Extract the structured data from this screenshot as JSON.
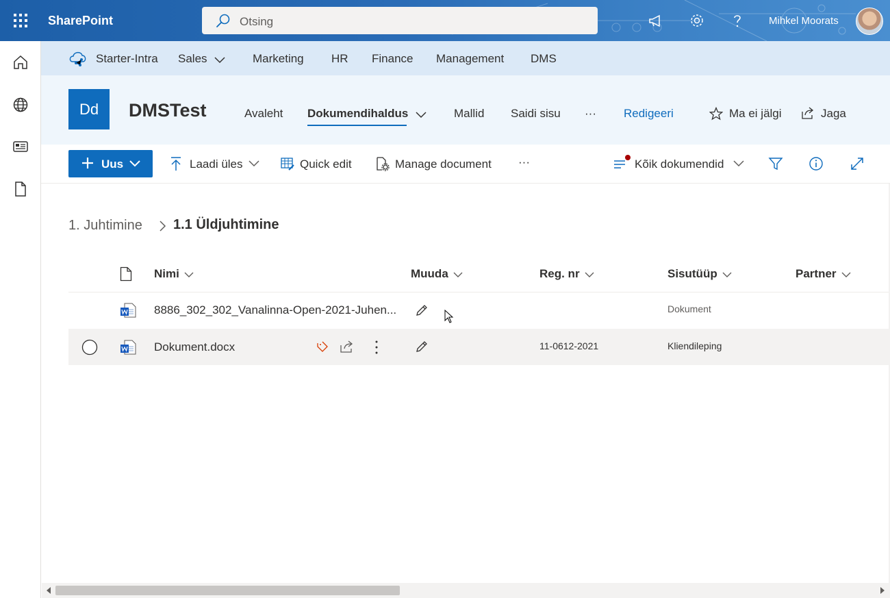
{
  "suitebar": {
    "app_name": "SharePoint",
    "search_placeholder": "Otsing",
    "user_name": "Mihkel Moorats"
  },
  "hubnav": {
    "items": [
      "Starter-Intra",
      "Sales",
      "Marketing",
      "HR",
      "Finance",
      "Management",
      "DMS"
    ]
  },
  "site": {
    "logo_text": "Dd",
    "title": "DMSTest",
    "nav": [
      "Avaleht",
      "Dokumendihaldus",
      "Mallid",
      "Saidi sisu",
      "···"
    ],
    "edit_label": "Redigeeri",
    "follow_label": "Ma ei jälgi",
    "share_label": "Jaga",
    "accent_color": "#0f6cbd"
  },
  "commandbar": {
    "new_label": "Uus",
    "upload_label": "Laadi üles",
    "quick_edit_label": "Quick edit",
    "manage_label": "Manage document",
    "more_label": "···",
    "view_label": "Kõik dokumendid"
  },
  "breadcrumb": {
    "parent": "1. Juhtimine",
    "current": "1.1 Üldjuhtimine"
  },
  "columns": [
    "Nimi",
    "Muuda",
    "Reg. nr",
    "Sisutüüp",
    "Partner"
  ],
  "rows": [
    {
      "name": "8886_302_302_Vanalinna-Open-2021-Juhen...",
      "reg_nr": "",
      "content_type": "Dokument",
      "partner": "",
      "selected": false
    },
    {
      "name": "Dokument.docx",
      "reg_nr": "11-0612-2021",
      "content_type": "Kliendileping",
      "partner": "",
      "selected": true
    }
  ]
}
